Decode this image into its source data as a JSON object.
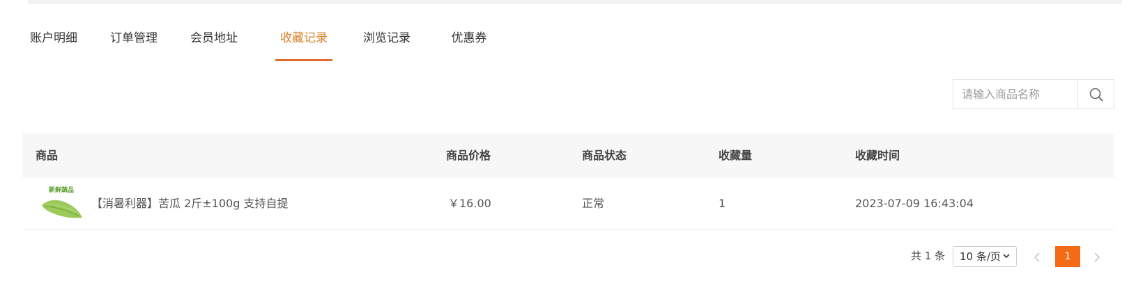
{
  "tabs": [
    {
      "label": "账户明细",
      "active": false
    },
    {
      "label": "订单管理",
      "active": false
    },
    {
      "label": "会员地址",
      "active": false
    },
    {
      "label": "收藏记录",
      "active": true
    },
    {
      "label": "浏览记录",
      "active": false
    },
    {
      "label": "优惠券",
      "active": false
    }
  ],
  "search": {
    "placeholder": "请输入商品名称",
    "icon": "search-icon"
  },
  "table": {
    "headers": [
      "商品",
      "商品价格",
      "商品状态",
      "收藏量",
      "收藏时间"
    ],
    "rows": [
      {
        "thumb_label": "新鲜蔬品",
        "product": "【消暑利器】苦瓜 2斤±100g 支持自提",
        "price": "￥16.00",
        "status": "正常",
        "favorites": "1",
        "time": "2023-07-09 16:43:04"
      }
    ]
  },
  "pagination": {
    "total": "共 1 条",
    "page_size": "10 条/页",
    "current_page": "1"
  },
  "colors": {
    "accent": "#e56b2a",
    "active_tab_text": "#d9822b",
    "page_button": "#f36b16"
  }
}
